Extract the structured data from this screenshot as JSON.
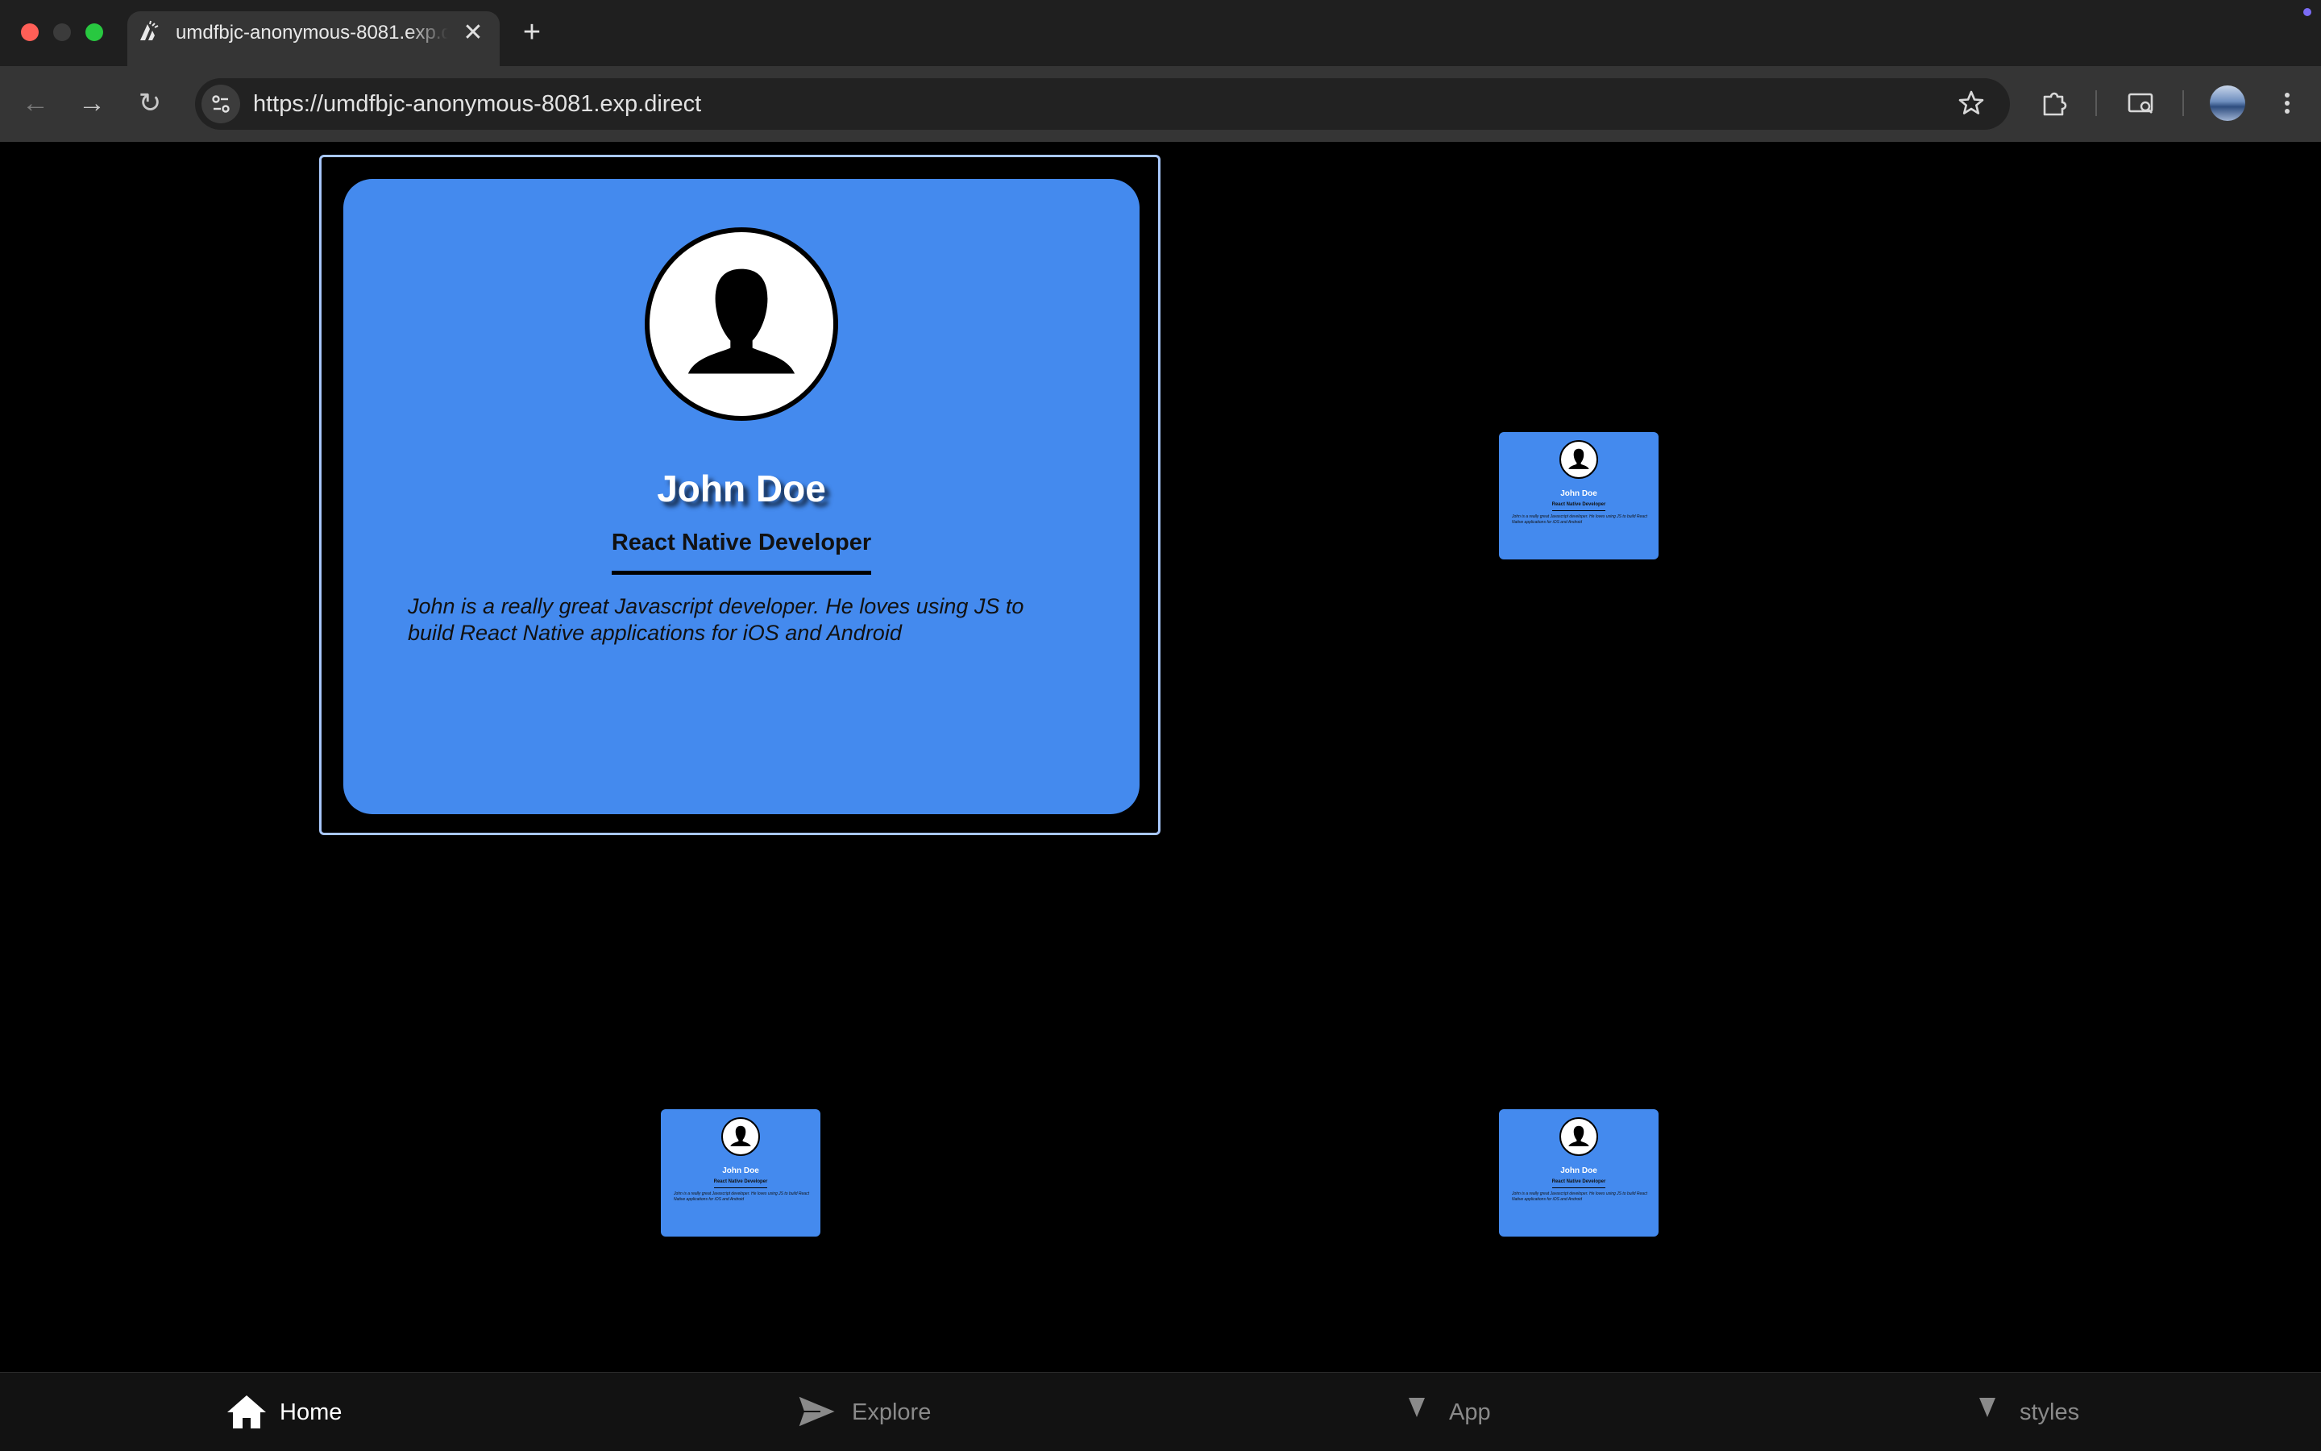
{
  "browser": {
    "tab_title": "umdfbjc-anonymous-8081.exp.direct",
    "url": "https://umdfbjc-anonymous-8081.exp.direct",
    "traffic_colors": [
      "#ff5f57",
      "#3b3b3b",
      "#28c840"
    ]
  },
  "profile_card": {
    "name": "John Doe",
    "role": "React Native Developer",
    "bio": "John is a really great Javascript developer. He loves using JS to build React Native applications for iOS and Android",
    "bio_line1": "John is a really great Javascript developer. He loves using JS to",
    "bio_line2": "build React Native applications for iOS and Android",
    "card_color": "#448aee",
    "focus_color": "#a8c7fa"
  },
  "tab_bar": {
    "items": [
      {
        "label": "Home",
        "icon": "home-icon",
        "active": true
      },
      {
        "label": "Explore",
        "icon": "send-icon",
        "active": false
      },
      {
        "label": "App",
        "icon": "triangle-down-icon",
        "active": false
      },
      {
        "label": "styles",
        "icon": "triangle-down-icon",
        "active": false
      }
    ]
  }
}
